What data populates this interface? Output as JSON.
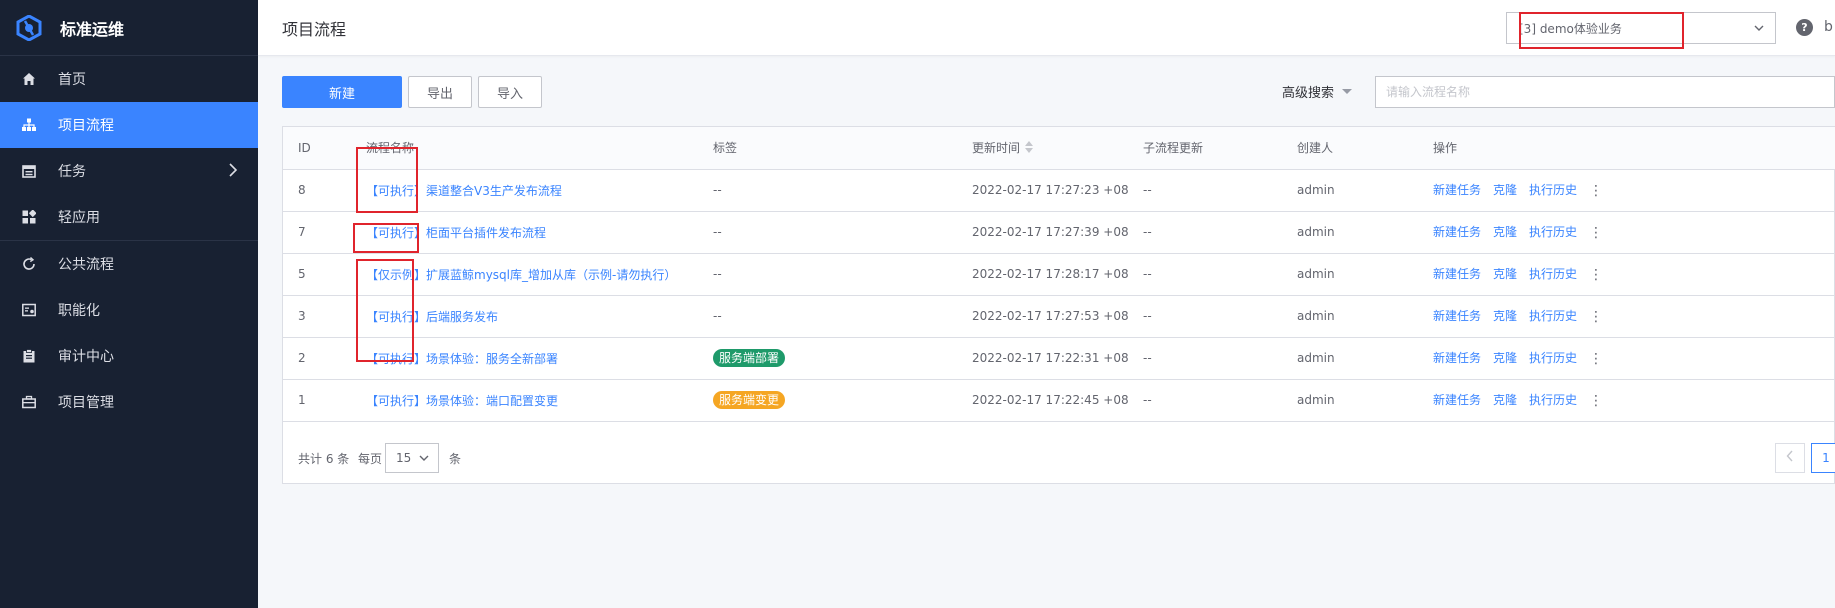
{
  "brand": {
    "title": "标准运维"
  },
  "sidebar": {
    "items": [
      {
        "label": "首页",
        "icon": "home-icon"
      },
      {
        "label": "项目流程",
        "icon": "sitemap-icon",
        "active": true
      },
      {
        "label": "任务",
        "icon": "calendar-icon",
        "has_children": true
      },
      {
        "label": "轻应用",
        "icon": "grid-apps-icon"
      },
      {
        "label": "公共流程",
        "icon": "refresh-icon"
      },
      {
        "label": "职能化",
        "icon": "id-card-icon"
      },
      {
        "label": "审计中心",
        "icon": "clipboard-icon"
      },
      {
        "label": "项目管理",
        "icon": "briefcase-icon"
      }
    ]
  },
  "header": {
    "title": "项目流程",
    "business_select": "[3] demo体验业务",
    "help": "?",
    "user_initial": "b"
  },
  "toolbar": {
    "new_label": "新建",
    "export_label": "导出",
    "import_label": "导入",
    "advanced_search": "高级搜索",
    "search_placeholder": "请输入流程名称"
  },
  "table": {
    "columns": [
      "ID",
      "流程名称",
      "标签",
      "更新时间",
      "子流程更新",
      "创建人",
      "操作"
    ],
    "rows": [
      {
        "id": "8",
        "prefix": "【可执行】",
        "name": "渠道整合V3生产发布流程",
        "tag": "--",
        "updated": "2022-02-17 17:27:23 +0800",
        "sub": "--",
        "creator": "admin"
      },
      {
        "id": "7",
        "prefix": "【可执行】",
        "name": "柜面平台插件发布流程",
        "tag": "--",
        "updated": "2022-02-17 17:27:39 +0800",
        "sub": "--",
        "creator": "admin"
      },
      {
        "id": "5",
        "prefix": "【仅示例】",
        "name": "扩展蓝鲸mysql库_增加从库（示例-请勿执行）",
        "tag": "--",
        "updated": "2022-02-17 17:28:17 +0800",
        "sub": "--",
        "creator": "admin"
      },
      {
        "id": "3",
        "prefix": "【可执行】",
        "name": "后端服务发布",
        "tag": "--",
        "updated": "2022-02-17 17:27:53 +0800",
        "sub": "--",
        "creator": "admin"
      },
      {
        "id": "2",
        "prefix": "【可执行】",
        "name": "场景体验：服务全新部署",
        "tag": "服务端部署",
        "tag_color": "#1e9a6a",
        "updated": "2022-02-17 17:22:31 +0800",
        "sub": "--",
        "creator": "admin"
      },
      {
        "id": "1",
        "prefix": "【可执行】",
        "name": "场景体验：端口配置变更",
        "tag": "服务端变更",
        "tag_color": "#f5a623",
        "updated": "2022-02-17 17:22:45 +0800",
        "sub": "--",
        "creator": "admin"
      }
    ],
    "actions": {
      "new_task": "新建任务",
      "clone": "克隆",
      "history": "执行历史",
      "more": "⋮"
    }
  },
  "pager": {
    "total": "共计 6 条",
    "per_page_label": "每页",
    "page_size": "15",
    "unit": "条",
    "current_page": "1"
  },
  "colors": {
    "sidebar_bg": "#182132",
    "primary": "#3a84ff",
    "highlight": "#e0242c"
  }
}
